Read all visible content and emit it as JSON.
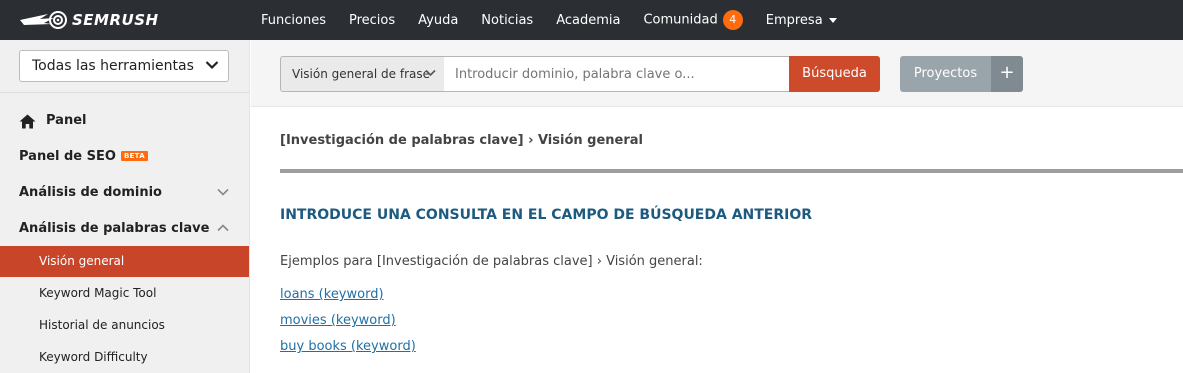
{
  "brand": {
    "name": "SEMRUSH"
  },
  "topnav": {
    "items": [
      "Funciones",
      "Precios",
      "Ayuda",
      "Noticias",
      "Academia",
      "Comunidad",
      "Empresa"
    ],
    "community_badge": "4"
  },
  "sidebar": {
    "tools_select": "Todas las herramientas",
    "items": [
      {
        "label": "Panel",
        "icon": "home-icon"
      },
      {
        "label": "Panel de SEO",
        "badge": "BETA"
      },
      {
        "label": "Análisis de dominio",
        "icon": "chevron-down-icon"
      },
      {
        "label": "Análisis de palabras clave",
        "icon": "chevron-up-icon"
      }
    ],
    "subitems": [
      {
        "label": "Visión general",
        "active": true
      },
      {
        "label": "Keyword Magic Tool",
        "active": false
      },
      {
        "label": "Historial de anuncios",
        "active": false
      },
      {
        "label": "Keyword Difficulty",
        "active": false
      }
    ]
  },
  "search": {
    "report_select": "Visión general de frase",
    "placeholder": "Introducir dominio, palabra clave o...",
    "button": "Búsqueda",
    "projects_button": "Proyectos",
    "add_button": "+"
  },
  "main": {
    "breadcrumb": "[Investigación de palabras clave] › Visión general",
    "headline": "INTRODUCE UNA CONSULTA EN EL CAMPO DE BÚSQUEDA ANTERIOR",
    "examples_label": "Ejemplos para [Investigación de palabras clave] › Visión general:",
    "examples": [
      "loans (keyword)",
      "movies (keyword)",
      "buy books (keyword)"
    ]
  },
  "colors": {
    "topbar": "#2b2e33",
    "accent": "#c8452a",
    "badge": "#ff6b0d",
    "link": "#1f70a6",
    "headline": "#1d5a80"
  }
}
